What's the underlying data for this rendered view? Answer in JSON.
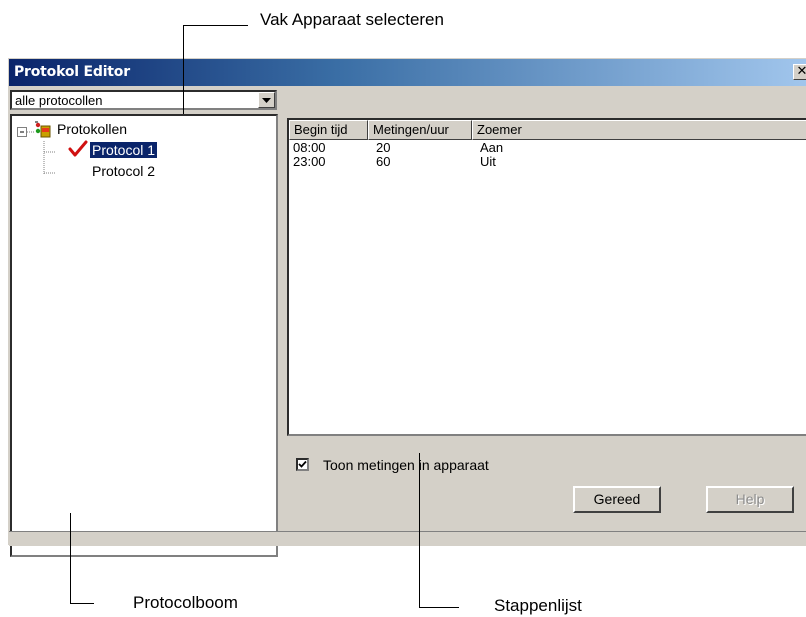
{
  "callouts": {
    "top": "Vak Apparaat selecteren",
    "bottom_left": "Protocolboom",
    "bottom_right": "Stappenlijst"
  },
  "window": {
    "title": "Protokol Editor",
    "close_symbol": "✕"
  },
  "device_select": {
    "value": "alle protocollen"
  },
  "tree": {
    "root": "Protokollen",
    "items": [
      "Protocol 1",
      "Protocol 2"
    ],
    "selected": "Protocol 1"
  },
  "steps": {
    "columns": [
      "Begin tijd",
      "Metingen/uur",
      "Zoemer"
    ],
    "rows": [
      [
        "08:00",
        "20",
        "Aan"
      ],
      [
        "23:00",
        "60",
        "Uit"
      ]
    ]
  },
  "options": {
    "show_measurements_label": "Toon metingen in apparaat",
    "show_measurements_checked": true
  },
  "buttons": {
    "done": "Gereed",
    "help": "Help"
  },
  "icons": {
    "root": "protocol-folder-icon",
    "active_marker": "red-checkmark-icon",
    "expand": "collapse-minus-icon",
    "dropdown": "chevron-down-icon"
  }
}
